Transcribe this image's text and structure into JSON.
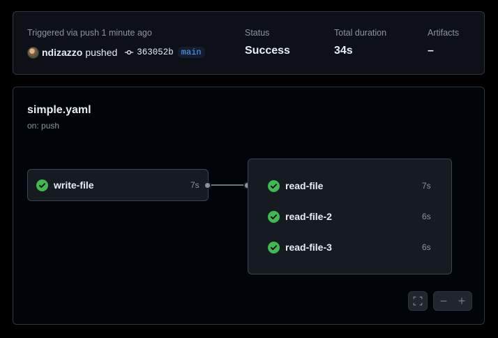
{
  "summary": {
    "trigger_label": "Triggered via push 1 minute ago",
    "actor": "ndizazzo",
    "action": "pushed",
    "commit_sha": "363052b",
    "branch": "main",
    "status_label": "Status",
    "status_value": "Success",
    "duration_label": "Total duration",
    "duration_value": "34s",
    "artifacts_label": "Artifacts",
    "artifacts_value": "–"
  },
  "workflow": {
    "name": "simple.yaml",
    "trigger": "on: push",
    "jobs": [
      {
        "name": "write-file",
        "duration": "7s",
        "status": "success"
      }
    ],
    "matrix_jobs": [
      {
        "name": "read-file",
        "duration": "7s",
        "status": "success"
      },
      {
        "name": "read-file-2",
        "duration": "6s",
        "status": "success"
      },
      {
        "name": "read-file-3",
        "duration": "6s",
        "status": "success"
      }
    ]
  },
  "controls": {
    "zoom_out": "−",
    "zoom_in": "+"
  },
  "colors": {
    "success": "#3fb950",
    "branch_text": "#58a6ff",
    "muted": "#8b949e"
  },
  "icons": {
    "commit": "git-commit-icon",
    "check": "check-circle-icon",
    "fullscreen": "fullscreen-icon"
  }
}
